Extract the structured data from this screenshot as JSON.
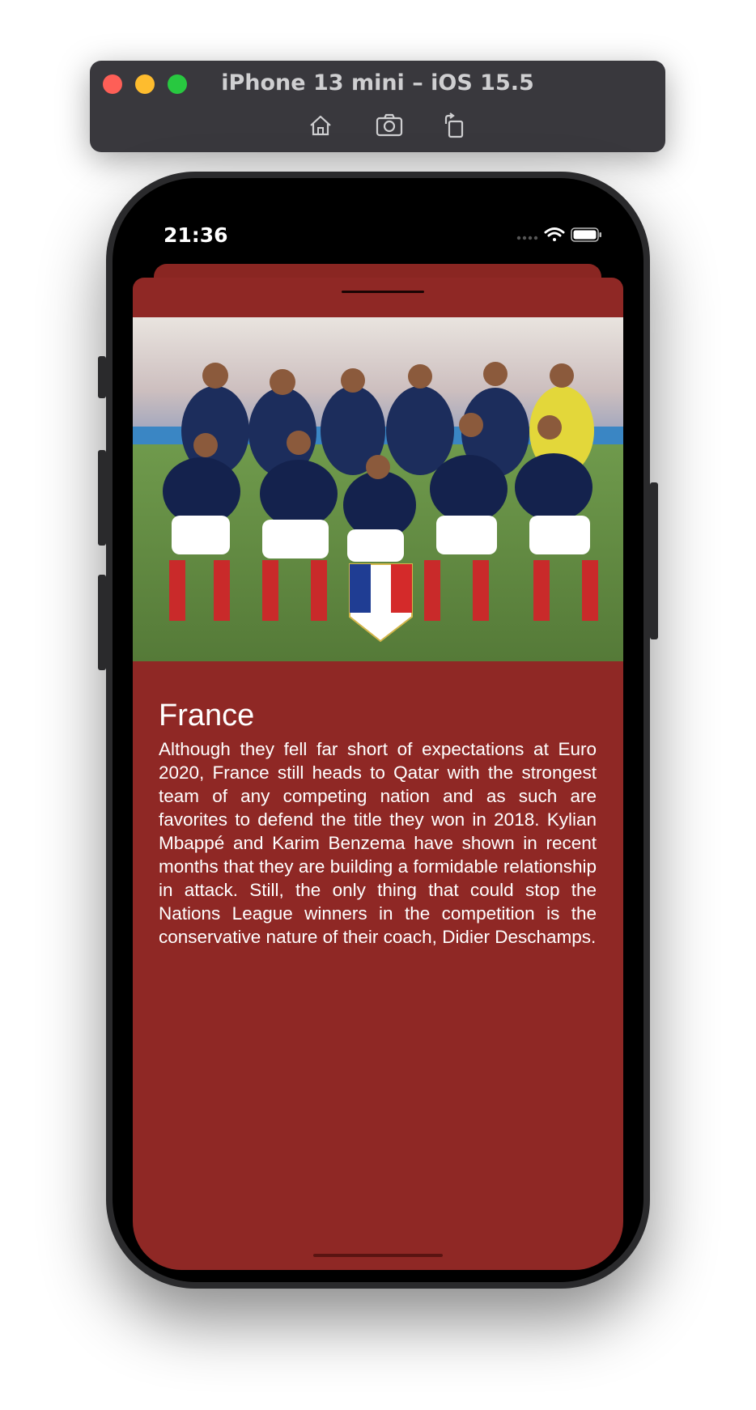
{
  "simulator": {
    "title": "iPhone 13 mini – iOS 15.5",
    "buttons": [
      "home-icon",
      "screenshot-icon",
      "rotate-icon"
    ]
  },
  "status_bar": {
    "time": "21:36",
    "icons": [
      "cellular-icon",
      "wifi-icon",
      "battery-icon"
    ]
  },
  "sheet": {
    "background_color": "#8f2825",
    "title": "France",
    "description": "Although they fell far short of expectations at Euro 2020, France still heads to Qatar with the strongest team of any competing nation and as such are favorites to defend the title they won in 2018. Kylian Mbappé and Karim Benzema have shown in recent months that they are building a formidable relationship in attack. Still, the only thing that could stop the Nations League winners in the competition is the conservative nature of their coach, Didier Deschamps."
  }
}
